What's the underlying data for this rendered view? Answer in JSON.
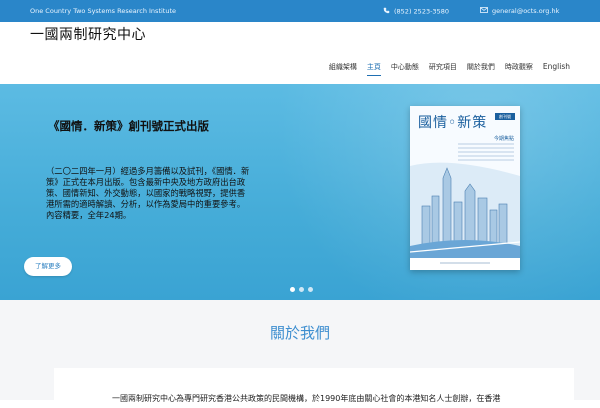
{
  "topbar": {
    "org_name": "One Country Two Systems Research Institute",
    "phone": "(852) 2523-3580",
    "email": "general@octs.org.hk"
  },
  "header": {
    "logo_text": "一國兩制研究中心",
    "nav": [
      "組織架構",
      "主頁",
      "中心動態",
      "研究項目",
      "關於我們",
      "時政觀察",
      "English"
    ],
    "active_nav": "主頁"
  },
  "hero": {
    "title": "《國情．新策》創刊號正式出版",
    "body": "（二〇二四年一月）經過多月籌備以及試刊，《國情．新策》正式在本月出版。包含最新中央及地方政府出台政策、國情新知、外交動態，以國家的戰略視野，提供香港所需的適時解讀、分析，以作為愛局中的重要參考。內容精要，全年24期。",
    "button_label": "了解更多",
    "cover": {
      "title": "國情◦新策",
      "badge": "創刊號",
      "subtitle": "今期焦點"
    },
    "slides": 3,
    "active_slide": 0
  },
  "about": {
    "title": "關於我們",
    "text": "一國兩制研究中心為專門研究香港公共政策的民間機構，於1990年底由關心社會的本港知名人士創辦，在香港"
  },
  "colors": {
    "topbar": "#2a86c9",
    "accent": "#1f6fb2",
    "hero_bg": "#45acd8",
    "about_title": "#3f8fd0"
  }
}
